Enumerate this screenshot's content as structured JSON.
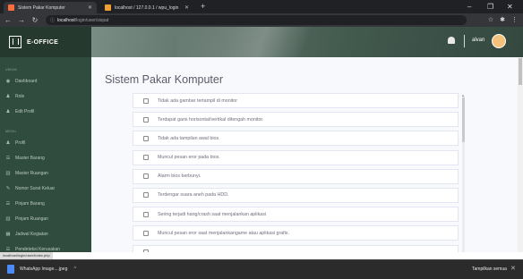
{
  "browser": {
    "tabs": [
      {
        "label": "Sistem Pakar Komputer",
        "icon": "app-favicon-icon",
        "color": "#ff6d3a"
      },
      {
        "label": "localhost / 127.0.0.1 / wpu_login",
        "icon": "phpmyadmin-favicon-icon",
        "color": "#f0a030"
      }
    ],
    "url_host": "localhost",
    "url_path": "/login/user/sispat",
    "status_url": "localhost/login/user/index.php"
  },
  "app": {
    "brand": "E-OFFICE",
    "user": "alvan",
    "accent": "#2f4c3f"
  },
  "sidebar": {
    "heading_top": "UMUM",
    "heading_mid": "MENU",
    "items": [
      {
        "label": "Dashboard",
        "icon": "dashboard-icon"
      },
      {
        "label": "Role",
        "icon": "user-icon"
      },
      {
        "label": "Edit Profil",
        "icon": "user-edit-icon"
      },
      {
        "label": "Profil",
        "icon": "user-icon"
      },
      {
        "label": "Master Barang",
        "icon": "list-icon"
      },
      {
        "label": "Master Ruangan",
        "icon": "building-icon"
      },
      {
        "label": "Nomor Surat Keluar",
        "icon": "edit-icon"
      },
      {
        "label": "Pinjam Barang",
        "icon": "list-icon"
      },
      {
        "label": "Pinjam Ruangan",
        "icon": "building-icon"
      },
      {
        "label": "Jadwal Kegiatan",
        "icon": "calendar-icon"
      },
      {
        "label": "Pendeteksi Kerusakan",
        "icon": "list-icon"
      }
    ]
  },
  "main": {
    "title": "Sistem Pakar Komputer",
    "questions": [
      "Tidak ada gambar tertampil di monitor",
      "Terdapat garis horisontal/vertikal ditengah monitor.",
      "Tidak ada tampilan awal bios.",
      "Muncul pesan eror pada bios.",
      "Alarm bios berbunyi.",
      "Terdengar suara aneh pada HDD.",
      "Sering terjadi hang/crash saat menjalankan aplikasi",
      "Muncul pesan eror saat menjalankangame atau aplikasi grafis."
    ]
  },
  "downloads": {
    "file": "WhatsApp Image....jpeg",
    "show_all": "Tampilkan semua"
  }
}
